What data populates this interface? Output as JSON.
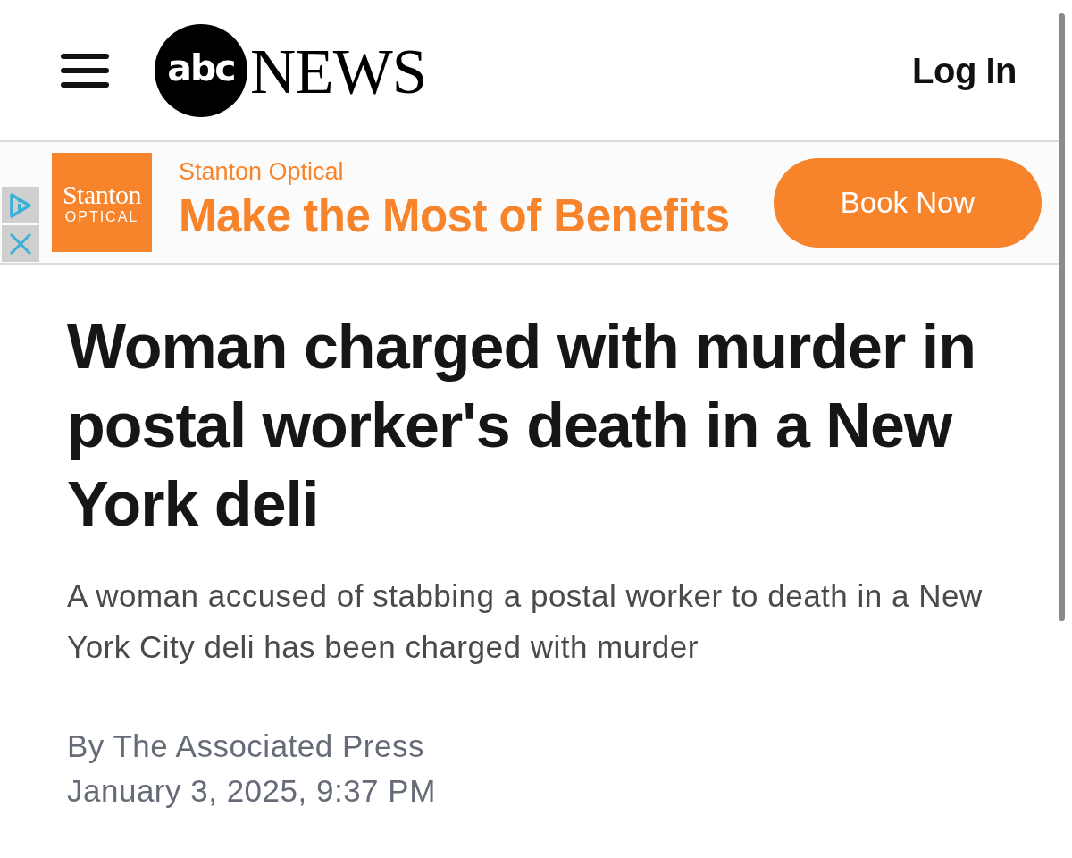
{
  "header": {
    "logo": {
      "mark": "abc",
      "wordmark": "NEWS"
    },
    "login": "Log In"
  },
  "ad": {
    "logo": {
      "name": "Stanton",
      "subtitle": "OPTICAL"
    },
    "advertiser": "Stanton Optical",
    "headline": "Make the Most of Benefits",
    "cta": "Book Now"
  },
  "article": {
    "headline": "Woman charged with murder in postal worker's death in a New York deli",
    "summary": "A woman accused of stabbing a postal worker to death in a New York City deli has been charged with murder",
    "byline": "By The Associated Press",
    "date": "January 3, 2025, 9:37 PM"
  }
}
